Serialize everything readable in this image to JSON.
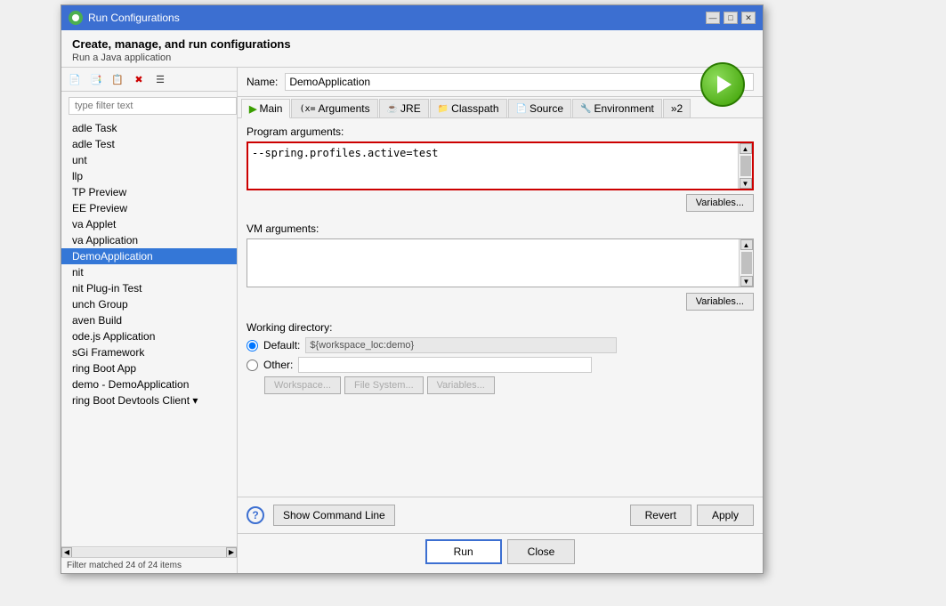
{
  "dialog": {
    "title": "Run Configurations",
    "subtitle": "Create, manage, and run configurations",
    "description": "Run a Java application"
  },
  "toolbar": {
    "buttons": [
      "📄",
      "✎",
      "📋",
      "✖",
      "☰"
    ]
  },
  "filter": {
    "placeholder": "type filter text",
    "status": "Filter matched 24 of 24 items"
  },
  "list_items": [
    {
      "label": "adle Task",
      "selected": false
    },
    {
      "label": "adle Test",
      "selected": false
    },
    {
      "label": "unt",
      "selected": false
    },
    {
      "label": "llp",
      "selected": false
    },
    {
      "label": "TP Preview",
      "selected": false
    },
    {
      "label": "EE Preview",
      "selected": false
    },
    {
      "label": "va Applet",
      "selected": false
    },
    {
      "label": "va Application",
      "selected": false
    },
    {
      "label": "DemoApplication",
      "selected": true
    },
    {
      "label": "nit",
      "selected": false
    },
    {
      "label": "nit Plug-in Test",
      "selected": false
    },
    {
      "label": "unch Group",
      "selected": false
    },
    {
      "label": "aven Build",
      "selected": false
    },
    {
      "label": "ode.js Application",
      "selected": false
    },
    {
      "label": "sGi Framework",
      "selected": false
    },
    {
      "label": "ring Boot App",
      "selected": false
    },
    {
      "label": "demo - DemoApplication",
      "selected": false
    },
    {
      "label": "ring Boot Devtools Client",
      "selected": false
    }
  ],
  "name_field": {
    "label": "Name:",
    "value": "DemoApplication"
  },
  "tabs": [
    {
      "label": "Main",
      "icon": "▶",
      "active": true
    },
    {
      "label": "Arguments",
      "icon": "(x=",
      "active": false
    },
    {
      "label": "JRE",
      "icon": "☕",
      "active": false
    },
    {
      "label": "Classpath",
      "icon": "📁",
      "active": false
    },
    {
      "label": "Source",
      "icon": "📄",
      "active": false
    },
    {
      "label": "Environment",
      "icon": "🔧",
      "active": false
    },
    {
      "label": "»2",
      "icon": "",
      "active": false
    }
  ],
  "main_tab": {
    "program_args_label": "Program arguments:",
    "program_args_value": "--spring.profiles.active=test",
    "variables_btn_1": "Variables...",
    "vm_args_label": "VM arguments:",
    "vm_args_value": "",
    "variables_btn_2": "Variables...",
    "working_dir_label": "Working directory:",
    "default_label": "Default:",
    "default_value": "${workspace_loc:demo}",
    "other_label": "Other:",
    "workspace_btn": "Workspace...",
    "filesystem_btn": "File System...",
    "variables_btn_3": "Variables..."
  },
  "bottom_buttons": {
    "show_cmdline": "Show Command Line",
    "revert": "Revert",
    "apply": "Apply",
    "run": "Run",
    "close": "Close"
  }
}
